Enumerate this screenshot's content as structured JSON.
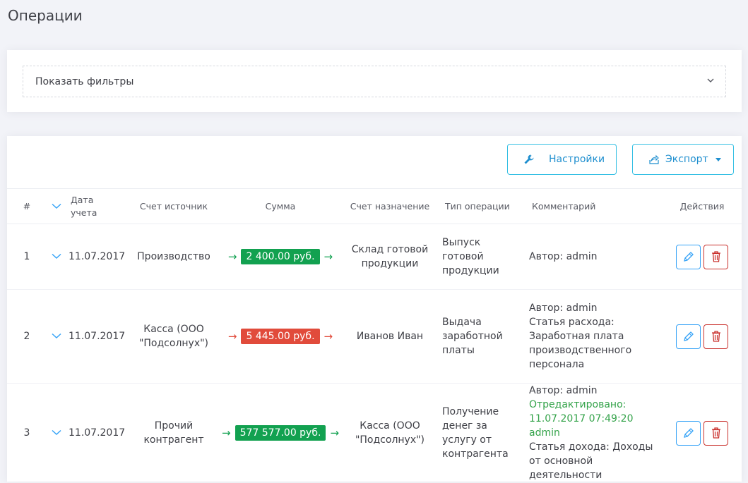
{
  "page": {
    "title": "Операции"
  },
  "filters": {
    "toggle_label": "Показать фильтры"
  },
  "toolbar": {
    "settings_label": "Настройки",
    "export_label": "Экспорт"
  },
  "table": {
    "headers": [
      "#",
      "",
      "Дата учета",
      "Счет источник",
      "Сумма",
      "Счет назначение",
      "Тип операции",
      "Комментарий",
      "Действия"
    ],
    "rows": [
      {
        "num": "1",
        "date": "11.07.2017",
        "source": "Производство",
        "amount": "2 400.00 руб.",
        "amount_kind": "transfer",
        "destination": "Склад готовой продукции",
        "type": "Выпуск готовой продукции",
        "comment": [
          "Автор: admin"
        ],
        "edited": []
      },
      {
        "num": "2",
        "date": "11.07.2017",
        "source": "Касса (ООО \"Подсолнух\")",
        "amount": "5 445.00 руб.",
        "amount_kind": "expense",
        "destination": "Иванов Иван",
        "type": "Выдача заработной платы",
        "comment": [
          "Автор: admin",
          "Статья расхода: Заработная плата производственного персонала"
        ],
        "edited": []
      },
      {
        "num": "3",
        "date": "11.07.2017",
        "source": "Прочий контрагент",
        "amount": "577 577.00 руб.",
        "amount_kind": "income",
        "destination": "Касса (ООО \"Подсолнух\")",
        "type": "Получение денег за услугу от контрагента",
        "comment": [
          "Автор: admin",
          "Статья дохода: Доходы от основной деятельности"
        ],
        "edited": [
          "Отредактировано: 11.07.2017 07:49:20 admin"
        ]
      }
    ]
  },
  "colors": {
    "income": "#12a150",
    "transfer": "#12a150",
    "expense": "#e14b3b",
    "accent": "#36a3f7",
    "danger": "#c9302c",
    "edited_text": "#34a34a"
  },
  "icons": {
    "chevron": "chevron-down-icon",
    "wrench": "wrench-icon",
    "export": "export-icon",
    "edit": "pencil-icon",
    "delete": "trash-icon",
    "arrow": "arrow-right-icon"
  }
}
